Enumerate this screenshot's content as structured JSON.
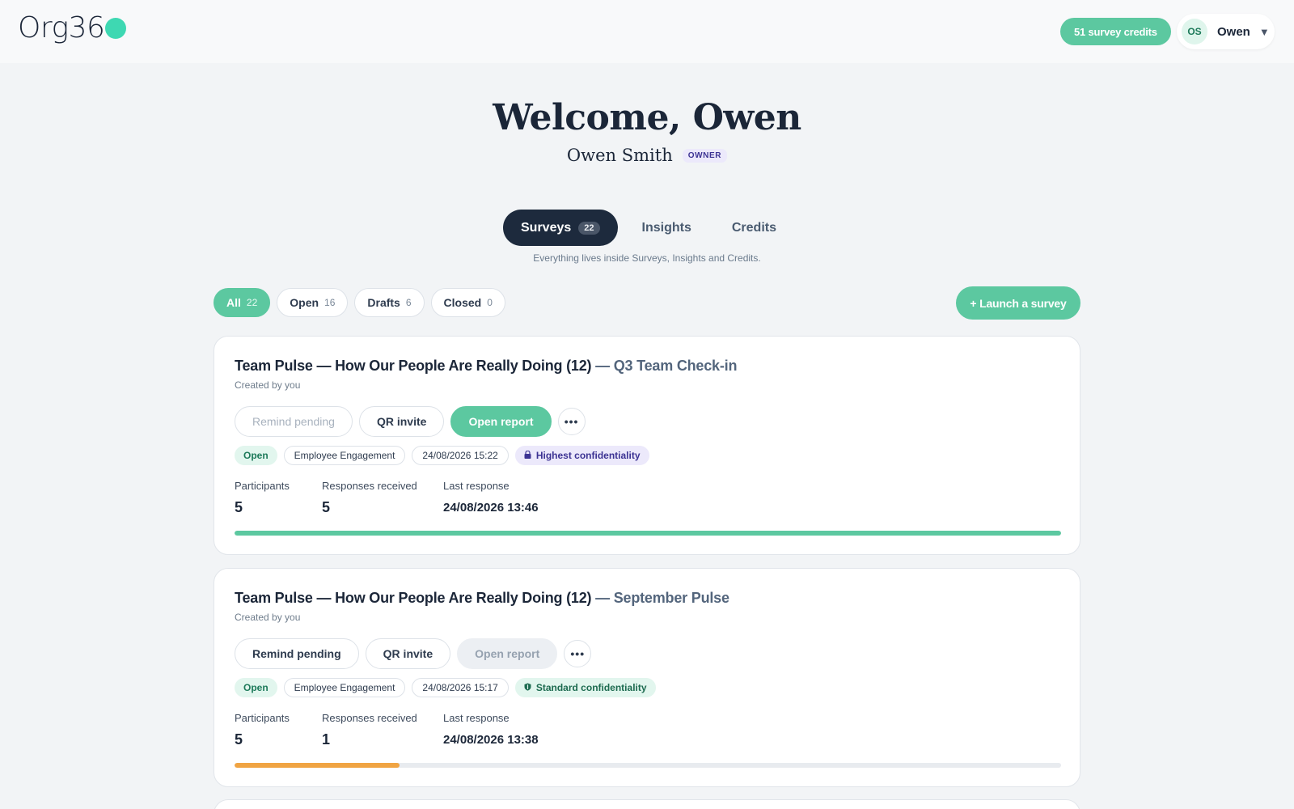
{
  "app": {
    "logo_text": "Org36",
    "credits_label": "51 survey credits",
    "user": {
      "initials": "OS",
      "name": "Owen",
      "caret": "▼"
    }
  },
  "welcome": {
    "title": "Welcome, Owen",
    "full_name": "Owen Smith",
    "role": "OWNER"
  },
  "tabs": [
    {
      "label": "Surveys",
      "count": "22",
      "active": true
    },
    {
      "label": "Insights"
    },
    {
      "label": "Credits"
    }
  ],
  "tabs_hint": "Everything lives inside Surveys, Insights and Credits.",
  "filters": [
    {
      "label": "All",
      "count": "22",
      "active": true
    },
    {
      "label": "Open",
      "count": "16"
    },
    {
      "label": "Drafts",
      "count": "6"
    },
    {
      "label": "Closed",
      "count": "0"
    }
  ],
  "launch_label": "+ Launch a survey",
  "colors": {
    "accent": "#5cc8a0",
    "progress_complete": "#5cc8a0",
    "progress_partial": "#f0a443"
  },
  "surveys": [
    {
      "title": "Team Pulse — How Our People Are Really Doing (12)",
      "subtitle": "— Q3 Team Check-in",
      "created_by": "Created by you",
      "actions": {
        "remind": "Remind pending",
        "qr": "QR invite",
        "report": "Open report",
        "more": "•••"
      },
      "status": "Open",
      "category": "Employee Engagement",
      "date": "24/08/2026 15:22",
      "confidentiality": "Highest confidentiality",
      "confidentiality_icon": "lock-icon",
      "stats": {
        "participants_label": "Participants",
        "participants": "5",
        "responses_label": "Responses received",
        "responses": "5",
        "last_label": "Last response",
        "last": "24/08/2026 13:46"
      },
      "response_rate": 1.0
    },
    {
      "title": "Team Pulse — How Our People Are Really Doing (12)",
      "subtitle": "— September Pulse",
      "created_by": "Created by you",
      "actions": {
        "remind": "Remind pending",
        "qr": "QR invite",
        "report": "Open report",
        "more": "•••"
      },
      "status": "Open",
      "category": "Employee Engagement",
      "date": "24/08/2026 15:17",
      "confidentiality": "Standard confidentiality",
      "confidentiality_icon": "shield-icon",
      "stats": {
        "participants_label": "Participants",
        "participants": "5",
        "responses_label": "Responses received",
        "responses": "1",
        "last_label": "Last response",
        "last": "24/08/2026 13:38"
      },
      "response_rate": 0.2
    }
  ]
}
